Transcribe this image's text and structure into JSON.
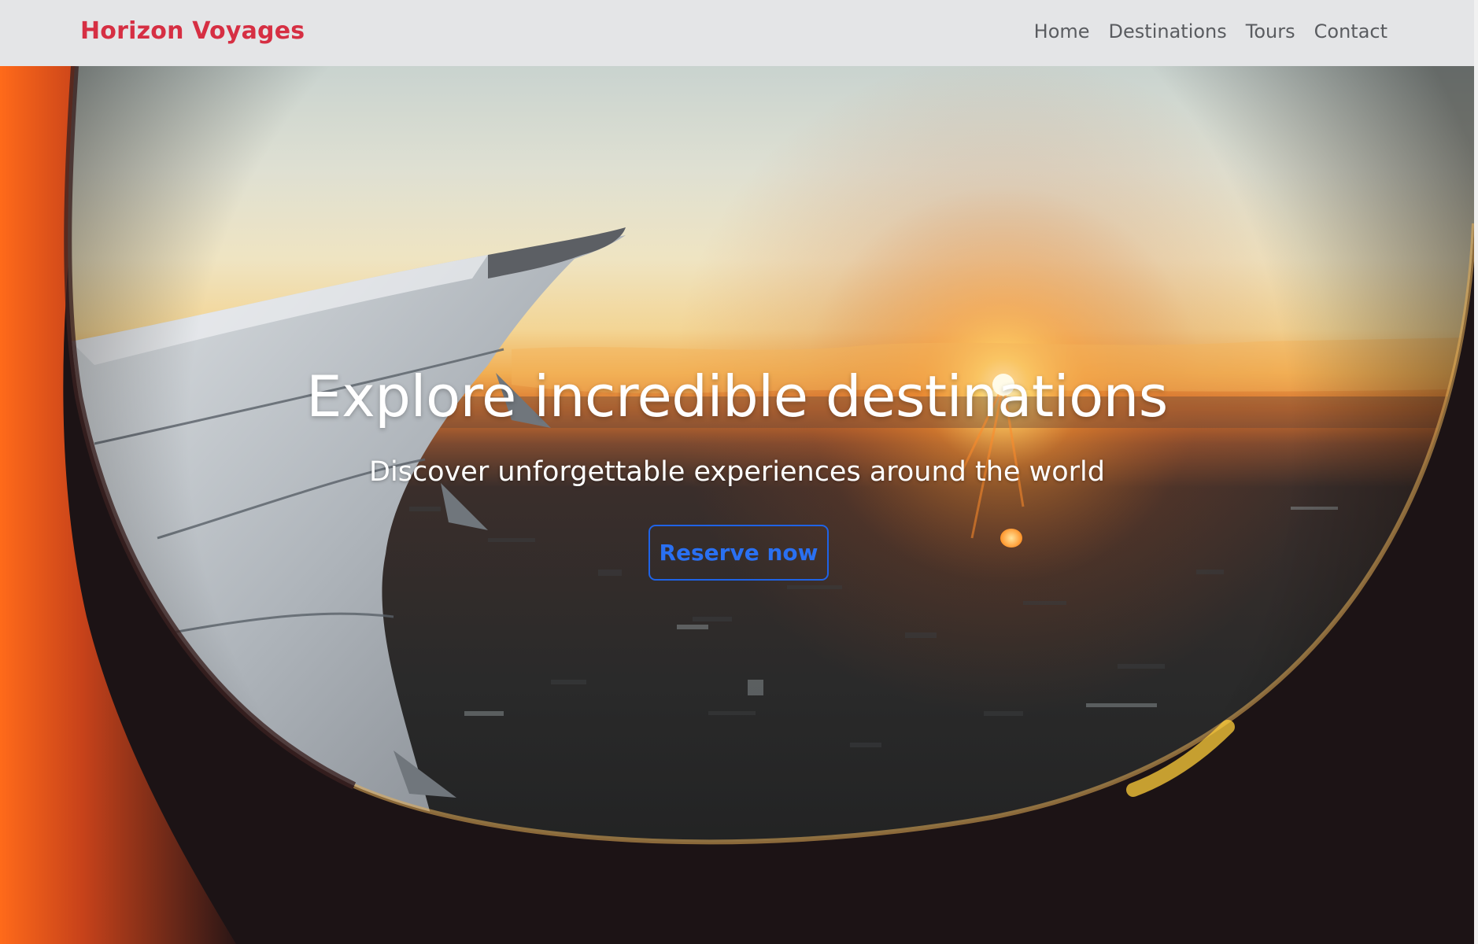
{
  "brand": {
    "name": "Horizon Voyages",
    "color": "#d62f43"
  },
  "nav": {
    "items": [
      {
        "label": "Home"
      },
      {
        "label": "Destinations"
      },
      {
        "label": "Tours"
      },
      {
        "label": "Contact"
      }
    ]
  },
  "hero": {
    "background_image": "airplane-window-sunset-view",
    "title": "Explore incredible destinations",
    "subtitle": "Discover unforgettable experiences around the world",
    "cta_label": "Reserve now",
    "cta_color": "#1f63e6"
  }
}
